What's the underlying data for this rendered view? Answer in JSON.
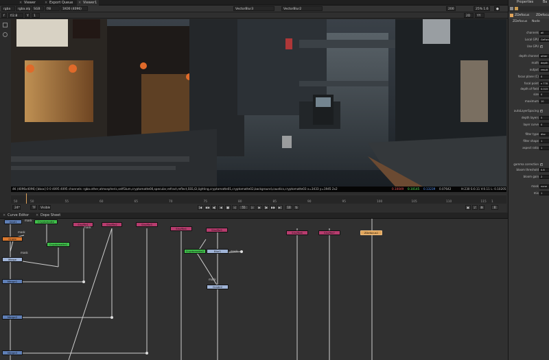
{
  "tabs": [
    {
      "label": "Viewer"
    },
    {
      "label": "Export Queue"
    },
    {
      "label": "Viewer1"
    }
  ],
  "viewer_bar": {
    "channels": "rgba",
    "layer": "rgba.alp",
    "colorspace": "SGB",
    "gain_label": "f/8",
    "proxy": "1K00 (4096)",
    "input_a": "VectorBlur3",
    "input_b": "VectorBlur2",
    "zoom": "200",
    "fps": "25% 1.6"
  },
  "viewer_bar2": {
    "frame_label": "f",
    "frame_value": "f/2.8",
    "y_label": "Y",
    "y_value": "1",
    "roi_label": "2D",
    "fov_label": "YY"
  },
  "status": {
    "text": "4K (4096x4096) [bbox] 0 0 4095 4095 channels: rgba.other,atmospheric,selfGlum,cryptomatte00,specular,refract,reflect,SSS,GI,lighting,cryptomatte01,cryptomatte02,background,caustics,cryptomatte03  x=3433 y=1945 2x2",
    "r": "0.10049",
    "g": "0.10145",
    "b": "0.13239",
    "a": "0.07642",
    "hsl": "H:230 S:0.11 V:0.11 L: 0.10205"
  },
  "timeline": {
    "start_frame": "50",
    "end_frame": "1",
    "current_frame": "55",
    "ticks": [
      "50",
      "55",
      "60",
      "65",
      "70",
      "75",
      "80",
      "85",
      "90",
      "95",
      "100",
      "105",
      "110",
      "115"
    ],
    "fps_field": "24*",
    "tf_field": "TF",
    "visible_field": "Visible",
    "step_value": "10",
    "end_value": "0"
  },
  "node_panel": {
    "tab_curve": "Curve Editor",
    "tab_dope": "Dope Sheet"
  },
  "nodes": [
    {
      "name": "read1",
      "color": "blue"
    },
    {
      "name": "Cryptomatte",
      "color": "green"
    },
    {
      "name": "Grade",
      "color": "orange"
    },
    {
      "name": "Cryptomatte1",
      "color": "green"
    },
    {
      "name": "Merge",
      "color": "lblue"
    },
    {
      "name": "Merge1",
      "color": "blue"
    },
    {
      "name": "Merge2",
      "color": "blue"
    },
    {
      "name": "Merge3",
      "color": "blue"
    },
    {
      "name": "Shuffle1",
      "color": "pink"
    },
    {
      "name": "Shuffle2",
      "color": "pink"
    },
    {
      "name": "Shuffle3",
      "color": "pink"
    },
    {
      "name": "Shuffle4",
      "color": "pink"
    },
    {
      "name": "Shuffle5",
      "color": "pink"
    },
    {
      "name": "Cryptomatte2",
      "color": "green"
    },
    {
      "name": "Blur1",
      "color": "lblue"
    },
    {
      "name": "Grade2",
      "color": "lblue"
    },
    {
      "name": "Shuffle6",
      "color": "pink"
    },
    {
      "name": "Shuffle7",
      "color": "pink"
    },
    {
      "name": "ZDefocus1",
      "color": "yellow"
    }
  ],
  "node_labels": {
    "mask1": "mask",
    "mask2": "mask",
    "mask3": "mask",
    "mask4": "mask",
    "mask5": "mask",
    "mask6": "mask"
  },
  "properties": {
    "tab_properties": "Properties",
    "tab_other": "Ba",
    "node_tab": "ZDefocus",
    "node_tab2": "ZDefocu",
    "subtab_a": "ZDefocus",
    "subtab_b": "Node",
    "rows": [
      {
        "label": "channels",
        "value": "all"
      },
      {
        "label": "Local GPU",
        "value": "GeForce"
      },
      {
        "label": "Use GPU",
        "value": ""
      },
      {
        "label": "depth channel",
        "value": "other"
      },
      {
        "label": "math",
        "value": "depth"
      },
      {
        "label": "output",
        "value": "result"
      },
      {
        "label": "focus plane (C)",
        "value": "0"
      },
      {
        "label": "focal point",
        "value": "x 778"
      },
      {
        "label": "depth of field",
        "value": "0.015"
      },
      {
        "label": "size",
        "value": "0"
      },
      {
        "label": "maximum",
        "value": "10"
      },
      {
        "label": "autoLayerSpacing",
        "value": ""
      },
      {
        "label": "depth layers",
        "value": "5"
      },
      {
        "label": "layer curve",
        "value": "0"
      },
      {
        "label": "filter type",
        "value": "disc"
      },
      {
        "label": "filter shape",
        "value": "1"
      },
      {
        "label": "aspect ratio",
        "value": "1"
      },
      {
        "label": "gamma correction",
        "value": ""
      },
      {
        "label": "bloom threshold",
        "value": "0.8"
      },
      {
        "label": "bloom gain",
        "value": "2"
      },
      {
        "label": "mask",
        "value": "none"
      },
      {
        "label": "mix",
        "value": "1"
      }
    ]
  },
  "colors": {
    "accent": "#e0a45b",
    "node_pink": "#b73c6e",
    "node_blue": "#5f7fb6",
    "node_green": "#3fbf4a",
    "playhead": "#e0a45b",
    "status_r": "#ff4d4d",
    "status_g": "#4dff4d",
    "status_b": "#4d8cff"
  },
  "icons": [
    "close-icon",
    "play-icon",
    "stop-icon",
    "prev-frame-icon",
    "next-frame-icon",
    "first-frame-icon",
    "last-frame-icon",
    "lock-icon"
  ]
}
